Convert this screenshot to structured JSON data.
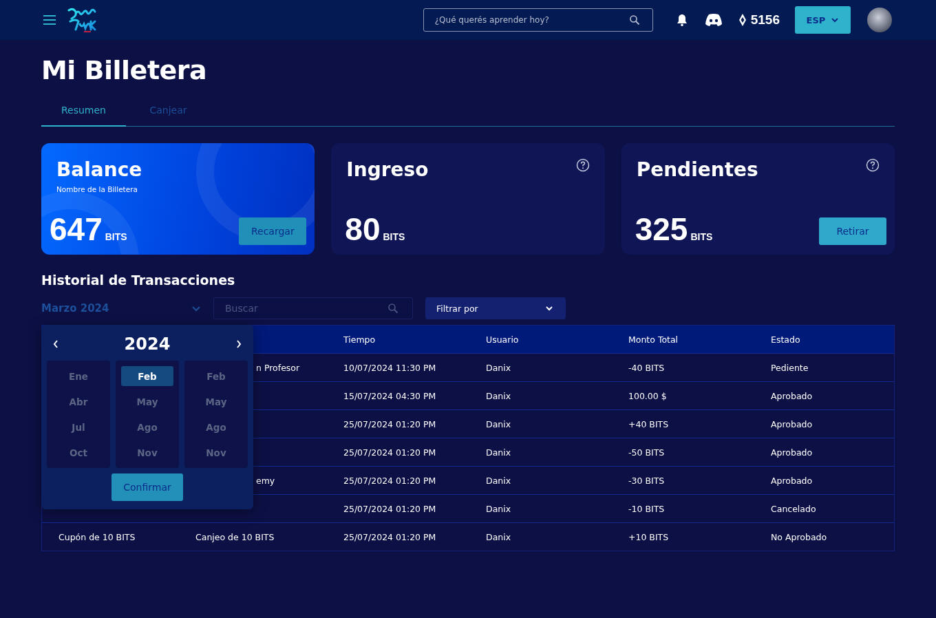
{
  "header": {
    "search": {
      "placeholder": "¿Qué querés aprender hoy?"
    },
    "points": "5156",
    "language": "ESP"
  },
  "title": "Mi Billetera",
  "tabs": [
    {
      "label": "Resumen",
      "selected": true
    },
    {
      "label": "Canjear",
      "selected": false
    }
  ],
  "cards": [
    {
      "kind": "balance",
      "title": "Balance",
      "subtitle": "Nombre de la Billetera",
      "amount": "647",
      "unit": "BITS",
      "button": "Recargar"
    },
    {
      "kind": "plain",
      "title": "Ingreso",
      "amount": "80",
      "unit": "BITS"
    },
    {
      "kind": "plain",
      "title": "Pendientes",
      "amount": "325",
      "unit": "BITS",
      "button": "Retirar"
    }
  ],
  "history": {
    "title": "Historial de Transacciones",
    "month": "Marzo 2024",
    "search": {
      "placeholder": "Buscar"
    },
    "filter": "Filtrar por"
  },
  "table": {
    "columns": [
      "Tiempo",
      "Usuario",
      "Monto Total",
      "Estado"
    ],
    "rows": [
      {
        "detail": "n Profesor",
        "time": "10/07/2024 11:30 PM",
        "user": "Danix",
        "amount": "-40 BITS",
        "status": "Pediente"
      },
      {
        "time": "15/07/2024 04:30 PM",
        "user": "Danix",
        "amount": "100.00 $",
        "status": "Aprobado"
      },
      {
        "time": "25/07/2024 01:20 PM",
        "user": "Danix",
        "amount": "+40 BITS",
        "status": "Aprobado"
      },
      {
        "time": "25/07/2024 01:20 PM",
        "user": "Danix",
        "amount": "-50 BITS",
        "status": "Aprobado"
      },
      {
        "detail": "emy",
        "time": "25/07/2024 01:20 PM",
        "user": "Danix",
        "amount": "-30 BITS",
        "status": "Aprobado"
      },
      {
        "time": "25/07/2024 01:20 PM",
        "user": "Danix",
        "amount": "-10 BITS",
        "status": "Cancelado"
      },
      {
        "concept": "Cupón de 10 BITS",
        "detail": "Canjeo de 10 BITS",
        "time": "25/07/2024 01:20 PM",
        "user": "Danix",
        "amount": "+10 BITS",
        "status": "No Aprobado"
      }
    ]
  },
  "picker": {
    "year": "2024",
    "columns": [
      [
        {
          "label": "Ene",
          "selected": false
        },
        {
          "label": "Abr",
          "selected": false
        },
        {
          "label": "Jul",
          "selected": false
        },
        {
          "label": "Oct",
          "selected": false
        }
      ],
      [
        {
          "label": "Feb",
          "selected": true
        },
        {
          "label": "May",
          "selected": false
        },
        {
          "label": "Ago",
          "selected": false
        },
        {
          "label": "Nov",
          "selected": false
        }
      ],
      [
        {
          "label": "Feb",
          "selected": false
        },
        {
          "label": "May",
          "selected": false
        },
        {
          "label": "Ago",
          "selected": false
        },
        {
          "label": "Nov",
          "selected": false
        }
      ]
    ],
    "confirm": "Confirmar"
  }
}
